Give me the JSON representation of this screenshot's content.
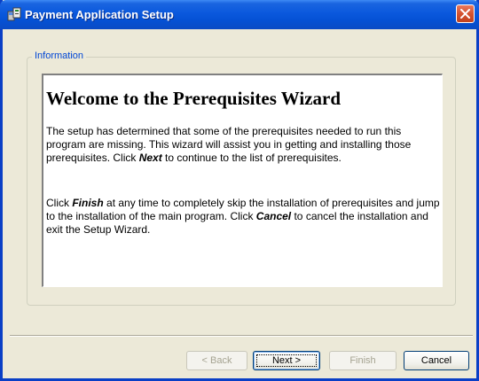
{
  "window": {
    "title": "Payment Application Setup",
    "app_icon": "setup-installer-icon",
    "close_icon": "close-icon"
  },
  "group": {
    "label": "Information"
  },
  "content": {
    "heading": "Welcome to the Prerequisites Wizard",
    "para1": {
      "part1": "The setup has determined that some of the prerequisites needed to run this program are missing. This wizard will assist you in getting and installing those prerequisites. Click ",
      "emph1": "Next",
      "part2": "  to continue to the list of prerequisites."
    },
    "para2": {
      "part1": "Click ",
      "emph1": "Finish",
      "part2": " at any time to completely skip the installation of prerequisites and jump to the installation of the main program. Click ",
      "emph2": "Cancel",
      "part3": " to cancel the installation and exit the Setup Wizard."
    }
  },
  "buttons": {
    "back": "< Back",
    "next": "Next >",
    "finish": "Finish",
    "cancel": "Cancel"
  },
  "colors": {
    "titlebar": "#0a58dd",
    "group_label": "#0046d5",
    "dialog_background": "#ece9d8"
  }
}
